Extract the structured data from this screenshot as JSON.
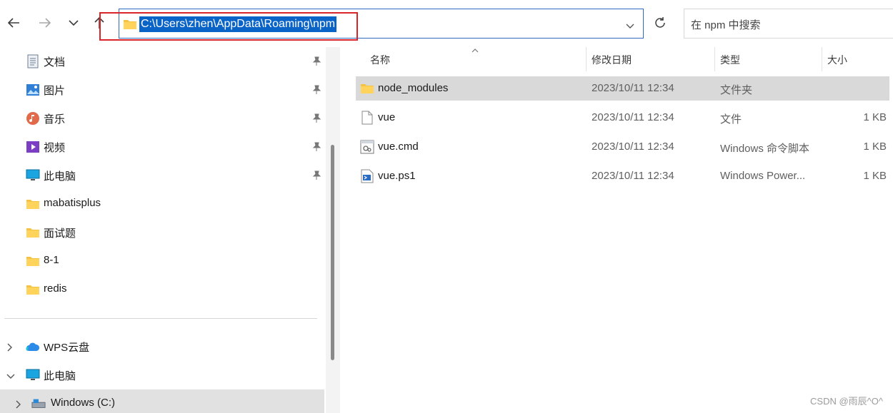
{
  "toolbar": {
    "back_icon": "arrow-left-icon",
    "forward_icon": "arrow-right-icon",
    "recent_icon": "chevron-down-icon",
    "up_icon": "arrow-up-icon",
    "refresh_icon": "refresh-icon"
  },
  "address_bar": {
    "path": "C:\\Users\\zhen\\AppData\\Roaming\\npm",
    "icon": "folder-icon",
    "selection_color": "#0a64c8",
    "highlight_border_color": "#d9242a"
  },
  "search": {
    "placeholder": "在 npm 中搜索"
  },
  "sidebar": {
    "quick_access": [
      {
        "label": "文档",
        "icon": "document-icon",
        "pinned": true
      },
      {
        "label": "图片",
        "icon": "picture-icon",
        "pinned": true
      },
      {
        "label": "音乐",
        "icon": "music-icon",
        "pinned": true
      },
      {
        "label": "视频",
        "icon": "video-icon",
        "pinned": true
      },
      {
        "label": "此电脑",
        "icon": "computer-icon",
        "pinned": true
      },
      {
        "label": "mabatisplus",
        "icon": "folder-icon",
        "pinned": false
      },
      {
        "label": "面试题",
        "icon": "folder-icon",
        "pinned": false
      },
      {
        "label": "8-1",
        "icon": "folder-icon",
        "pinned": false
      },
      {
        "label": "redis",
        "icon": "folder-icon",
        "pinned": false
      }
    ],
    "tree": [
      {
        "label": "WPS云盘",
        "icon": "cloud-icon",
        "expanded": false
      },
      {
        "label": "此电脑",
        "icon": "computer-icon",
        "expanded": true
      },
      {
        "label": "Windows (C:)",
        "icon": "drive-icon",
        "expanded": false,
        "selected": true
      }
    ]
  },
  "file_list": {
    "columns": [
      "名称",
      "修改日期",
      "类型",
      "大小"
    ],
    "rows": [
      {
        "name": "node_modules",
        "date": "2023/10/11 12:34",
        "type": "文件夹",
        "size": "",
        "icon": "folder-icon",
        "selected": true
      },
      {
        "name": "vue",
        "date": "2023/10/11 12:34",
        "type": "文件",
        "size": "1 KB",
        "icon": "file-icon",
        "selected": false
      },
      {
        "name": "vue.cmd",
        "date": "2023/10/11 12:34",
        "type": "Windows 命令脚本",
        "size": "1 KB",
        "icon": "cmd-script-icon",
        "selected": false
      },
      {
        "name": "vue.ps1",
        "date": "2023/10/11 12:34",
        "type": "Windows Power...",
        "size": "1 KB",
        "icon": "powershell-script-icon",
        "selected": false
      }
    ]
  },
  "watermark": "CSDN @雨辰^O^"
}
